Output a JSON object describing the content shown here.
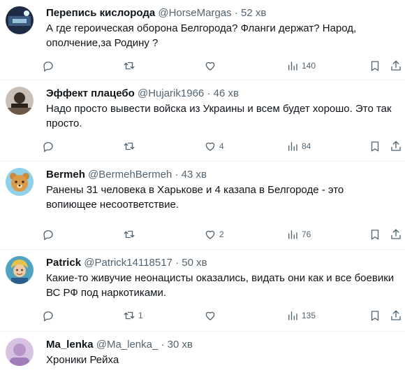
{
  "tweets": [
    {
      "name": "Перепись кислорода",
      "handle": "@HorseMargas",
      "time": "52 хв",
      "text": "А где героическая оборона Белгорода? Фланги держат? Народ, ополчение,за Родину ?",
      "replies": "",
      "retweets": "",
      "likes": "",
      "views": "140",
      "avatar_color": "#2a3f5f"
    },
    {
      "name": "Эффект плацебо",
      "handle": "@Hujarik1966",
      "time": "46 хв",
      "text": "Надо просто вывести войска из Украины и всем будет хорошо. Это так просто.",
      "replies": "",
      "retweets": "",
      "likes": "4",
      "views": "84",
      "avatar_color": "#4a3a2c"
    },
    {
      "name": "Bermeh",
      "handle": "@BermehBermeh",
      "time": "43 хв",
      "text": "Ранены 31 человека в Харькове и 4 казапа в Белгороде - это вопиющее несоответствие.",
      "replies": "",
      "retweets": "",
      "likes": "2",
      "views": "76",
      "avatar_color": "#7ec8e3"
    },
    {
      "name": "Patrick",
      "handle": "@Patrick14118517",
      "time": "50 хв",
      "text": "Какие-то живучие неонацисты оказались, видать они как и все боевики ВС РФ под наркотиками.",
      "replies": "",
      "retweets": "1",
      "likes": "",
      "views": "135",
      "avatar_color": "#5fb0c9"
    },
    {
      "name": "Ma_lenka",
      "handle": "@Ma_lenka_",
      "time": "30 хв",
      "text": "Хроники Рейха",
      "replies": "",
      "retweets": "",
      "likes": "",
      "views": "",
      "avatar_color": "#c9b0d8"
    }
  ],
  "separator": "·",
  "icons": [
    "reply-icon",
    "retweet-icon",
    "like-icon",
    "views-icon",
    "bookmark-icon",
    "share-icon"
  ]
}
